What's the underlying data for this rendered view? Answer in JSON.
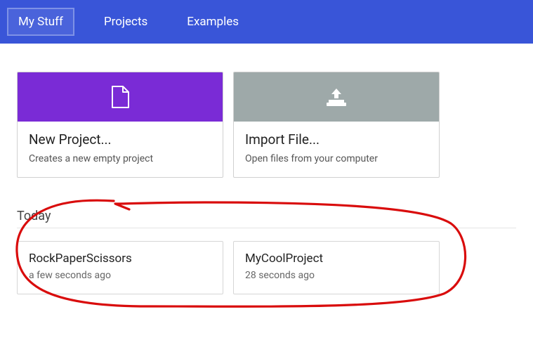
{
  "topbar": {
    "tabs": [
      {
        "label": "My Stuff",
        "active": true
      },
      {
        "label": "Projects",
        "active": false
      },
      {
        "label": "Examples",
        "active": false
      }
    ]
  },
  "actions": {
    "new_project": {
      "title": "New Project...",
      "desc": "Creates a new empty project"
    },
    "import_file": {
      "title": "Import File...",
      "desc": "Open files from your computer"
    }
  },
  "section_label": "Today",
  "projects": [
    {
      "name": "RockPaperScissors",
      "time": "a few seconds ago"
    },
    {
      "name": "MyCoolProject",
      "time": "28 seconds ago"
    }
  ],
  "colors": {
    "topbar": "#3955d8",
    "new_project_accent": "#7a2bd6",
    "import_accent": "#9ea9a9",
    "annotation": "#d90c0c"
  }
}
